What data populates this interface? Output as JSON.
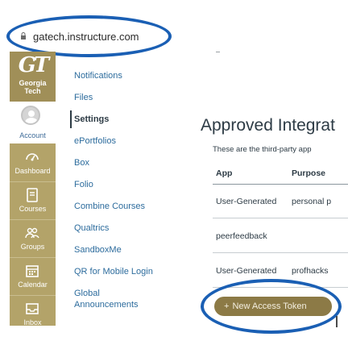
{
  "browser": {
    "url": "gatech.instructure.com"
  },
  "global_nav": {
    "logo": {
      "line1": "GT",
      "line2": "Georgia",
      "line3": "Tech"
    },
    "account_label": "Account",
    "items": [
      {
        "label": "Dashboard",
        "icon": "dashboard-icon"
      },
      {
        "label": "Courses",
        "icon": "courses-icon"
      },
      {
        "label": "Groups",
        "icon": "groups-icon"
      },
      {
        "label": "Calendar",
        "icon": "calendar-icon"
      },
      {
        "label": "Inbox",
        "icon": "inbox-icon"
      }
    ],
    "colors": {
      "background": "#b3a369",
      "logo_background": "#a08f58"
    }
  },
  "sub_nav": {
    "items": [
      {
        "label": "Notifications"
      },
      {
        "label": "Files"
      },
      {
        "label": "Settings",
        "active": true
      },
      {
        "label": "ePortfolios"
      },
      {
        "label": "Box"
      },
      {
        "label": "Folio"
      },
      {
        "label": "Combine Courses"
      },
      {
        "label": "Qualtrics"
      },
      {
        "label": "SandboxMe"
      },
      {
        "label": "QR for Mobile Login"
      },
      {
        "label": "Global"
      },
      {
        "label": "Announcements"
      }
    ]
  },
  "main": {
    "title": "Approved Integrat",
    "description": "These are the third-party app",
    "table": {
      "headers": [
        "App",
        "Purpose"
      ],
      "rows": [
        [
          "User-Generated",
          "personal p"
        ],
        [
          "peerfeedback",
          ""
        ],
        [
          "User-Generated",
          "profhacks"
        ]
      ]
    },
    "new_token_button": {
      "plus": "+",
      "label": "New Access Token"
    }
  },
  "colors": {
    "highlight_oval": "#1a5fb4",
    "button": "#8c7a46",
    "link": "#2d6c9d"
  }
}
